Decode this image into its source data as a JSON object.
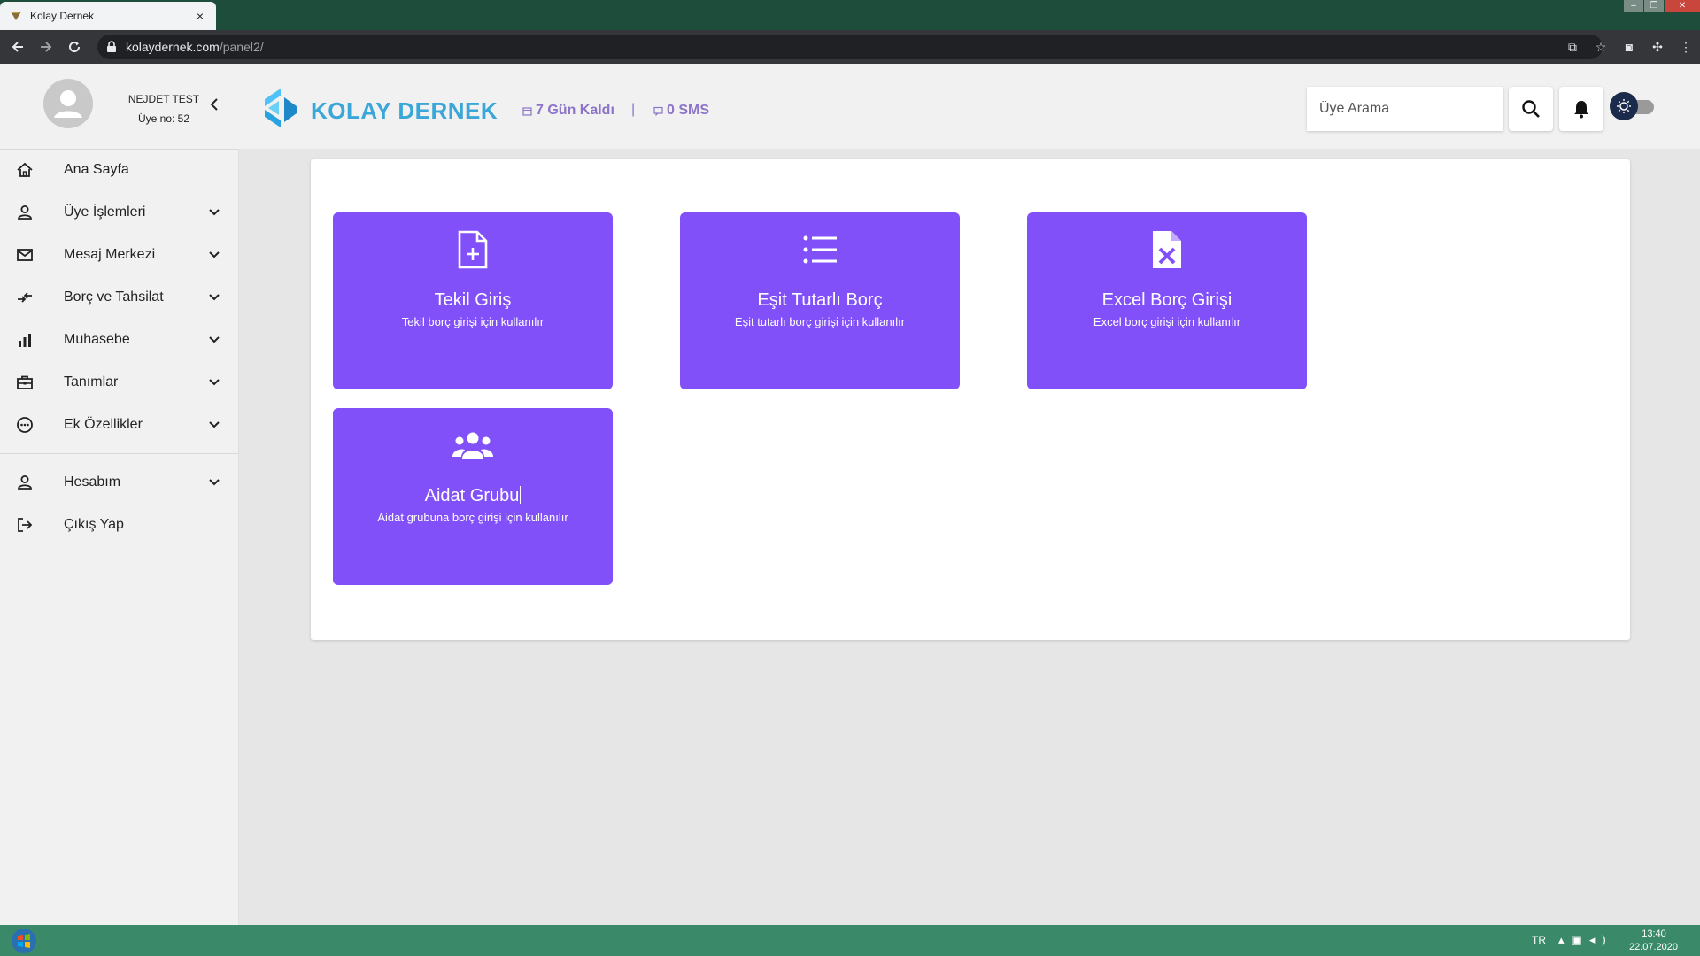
{
  "browser": {
    "tab_title": "Kolay Dernek",
    "tab_close": "×",
    "url_host": "kolaydernek.com",
    "url_path": "/panel2/"
  },
  "header": {
    "user_name": "NEJDET TEST",
    "user_no": "Üye no: 52",
    "brand": "KOLAY DERNEK",
    "days_left": "7 Gün Kaldı",
    "separator": "|",
    "sms": "0 SMS",
    "search_placeholder": "Üye Arama"
  },
  "colors": {
    "tile": "#8150f8",
    "brand": "#3ba7d8",
    "meta": "#8c74c8"
  },
  "sidebar": {
    "items": [
      {
        "label": "Ana Sayfa",
        "icon": "home-icon"
      },
      {
        "label": "Üye İşlemleri",
        "icon": "user-icon"
      },
      {
        "label": "Mesaj Merkezi",
        "icon": "mail-icon"
      },
      {
        "label": "Borç ve Tahsilat",
        "icon": "exchange-icon"
      },
      {
        "label": "Muhasebe",
        "icon": "bar-chart-icon"
      },
      {
        "label": "Tanımlar",
        "icon": "briefcase-icon"
      },
      {
        "label": "Ek Özellikler",
        "icon": "more-circle-icon"
      },
      {
        "label": "Hesabım",
        "icon": "user-icon"
      },
      {
        "label": "Çıkış Yap",
        "icon": "logout-icon"
      }
    ]
  },
  "tiles": [
    {
      "title": "Tekil Giriş",
      "desc": "Tekil borç girişi için kullanılır",
      "icon": "file-plus-icon"
    },
    {
      "title": "Eşit Tutarlı Borç",
      "desc": "Eşit tutarlı borç girişi için kullanılır",
      "icon": "list-icon"
    },
    {
      "title": "Excel Borç Girişi",
      "desc": "Excel borç girişi için kullanılır",
      "icon": "excel-file-icon"
    },
    {
      "title": "Aidat Grubu",
      "desc": "Aidat grubuna borç girişi için kullanılır",
      "icon": "users-icon"
    }
  ],
  "taskbar": {
    "lang": "TR",
    "time": "13:40",
    "date": "22.07.2020"
  }
}
